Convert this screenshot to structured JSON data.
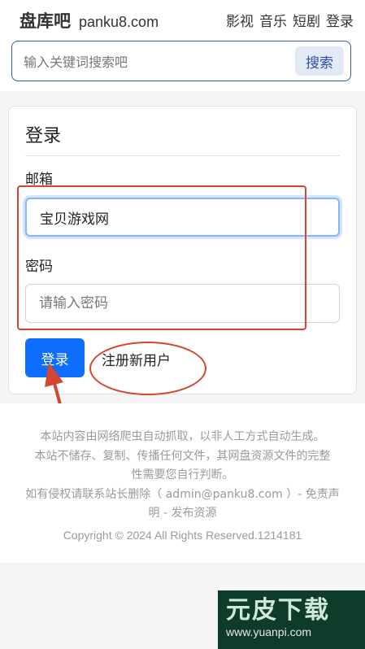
{
  "header": {
    "brand_name": "盘库吧",
    "brand_domain": "panku8.com",
    "nav": [
      "影视",
      "音乐",
      "短剧",
      "登录"
    ]
  },
  "search": {
    "placeholder": "输入关键词搜索吧",
    "button_label": "搜索"
  },
  "login": {
    "title": "登录",
    "email_label": "邮箱",
    "email_value": "宝贝游戏网",
    "password_label": "密码",
    "password_placeholder": "请输入密码",
    "submit_label": "登录",
    "register_label": "注册新用户"
  },
  "footer": {
    "line1": "本站内容由网络爬虫自动抓取，以非人工方式自动生成。",
    "line2": "本站不储存、复制、传播任何文件，其网盘资源文件的完整",
    "line3": "性需要您自行判断。",
    "line4": "如有侵权请联系站长删除（ admin@panku8.com ）- 免责声",
    "line5": "明 - 发布资源",
    "copyright": "Copyright © 2024 All Rights Reserved.1214181"
  },
  "watermark": {
    "big": "元皮下载",
    "small": "www.yuanpi.com"
  },
  "colors": {
    "primary": "#0d6efd",
    "annotation": "#d6452e"
  }
}
